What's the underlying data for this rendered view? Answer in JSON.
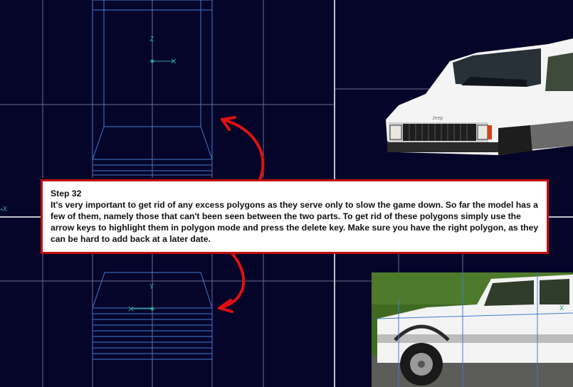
{
  "viewports": {
    "top_view": {
      "axis_v": "Z",
      "axis_h": "X"
    },
    "front_view": {
      "axis_v": "Y"
    },
    "side_view": {
      "axis_h": "X"
    },
    "left_edge_label": "→X"
  },
  "reference_images": {
    "front": {
      "subject": "white Jeep Cherokee, front view",
      "badge_text": "Jeep"
    },
    "side": {
      "subject": "white Jeep Cherokee, side view"
    }
  },
  "callout": {
    "title": "Step 32",
    "body": "It's very important to get rid of any excess polygons as they serve only to slow the game down. So far the model has a few of them, namely those that can't been seen between the two parts. To get rid of these polygons simply use the arrow keys  to highlight them in polygon mode and press the delete key. Make sure you have the right polygon, as they can be hard to add back at a later date."
  },
  "colors": {
    "viewport_bg": "#05052a",
    "grid": "#707090",
    "divider": "#b0b0b0",
    "wireframe": "#3f7cd0",
    "axis": "#2fa090",
    "callout_border": "#c41010",
    "arrow": "#e01010"
  }
}
